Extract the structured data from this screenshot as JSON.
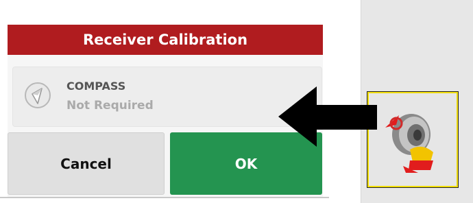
{
  "dialog": {
    "title": "Receiver Calibration",
    "title_color": "#b01c1f",
    "items": [
      {
        "name": "COMPASS",
        "status": "Not Required",
        "icon": "compass-icon"
      }
    ],
    "buttons": {
      "cancel_label": "Cancel",
      "ok_label": "OK",
      "ok_color": "#249450"
    }
  },
  "side_panel": {
    "receiver_button": {
      "icon": "receiver-calibration-icon",
      "highlight_color": "#f3df00"
    }
  },
  "annotation": {
    "icon": "pointer-arrow-icon",
    "color": "#000000"
  }
}
